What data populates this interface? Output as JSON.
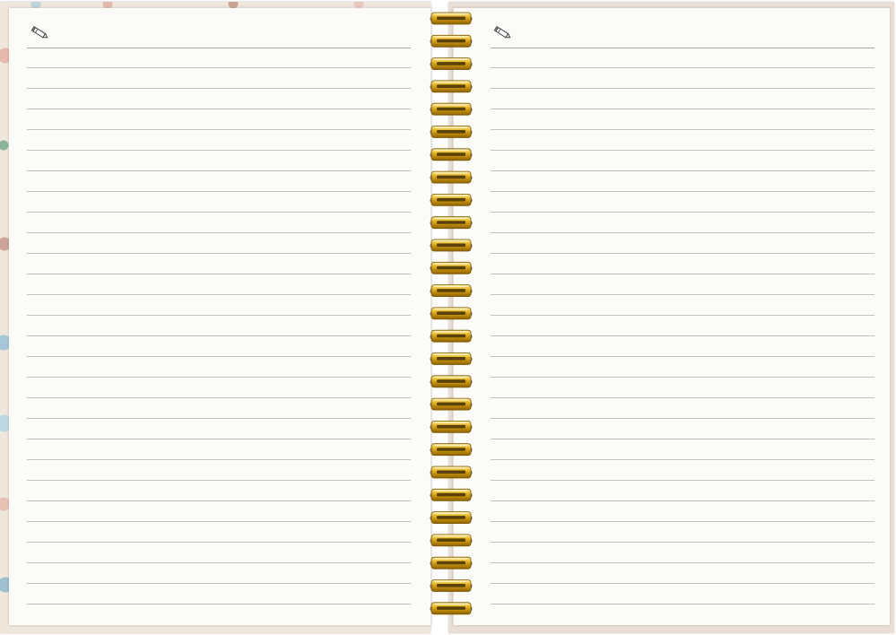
{
  "notebook": {
    "style": "spiral-bound lined notebook, open spread",
    "colors": {
      "page": "#fbfbf8",
      "rule_line": "#c2c2c2",
      "header_line": "#a9a9a9",
      "spiral_gold": "#d9a51c",
      "cover_left": "#efe6dc",
      "cover_right": "#e9dfd6"
    },
    "left_page": {
      "icon": "pencil-icon",
      "rule_count": 27
    },
    "right_page": {
      "icon": "pencil-icon",
      "rule_count": 27
    },
    "spiral": {
      "ring_count": 27,
      "color": "gold"
    }
  }
}
